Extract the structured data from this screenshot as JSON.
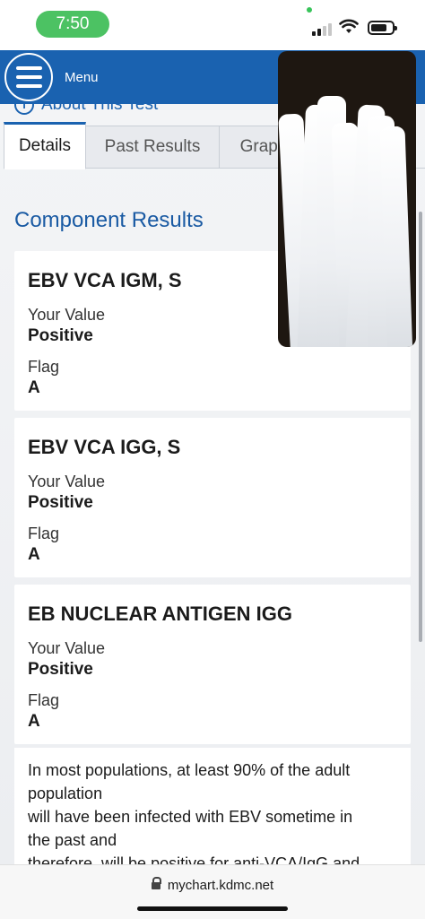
{
  "status_bar": {
    "time": "7:50"
  },
  "header": {
    "menu_label": "Menu"
  },
  "about_link": "About This Test",
  "tabs": [
    {
      "label": "Details",
      "active": true
    },
    {
      "label": "Past Results",
      "active": false
    },
    {
      "label": "Graph",
      "active": false
    }
  ],
  "section_title": "Component Results",
  "results": [
    {
      "name": "EBV VCA IGM, S",
      "value_label": "Your Value",
      "value": "Positive",
      "flag_label": "Flag",
      "flag": "A"
    },
    {
      "name": "EBV VCA IGG, S",
      "value_label": "Your Value",
      "value": "Positive",
      "flag_label": "Flag",
      "flag": "A"
    },
    {
      "name": "EB NUCLEAR ANTIGEN IGG",
      "value_label": "Your Value",
      "value": "Positive",
      "flag_label": "Flag",
      "flag": "A"
    }
  ],
  "note": {
    "lines": [
      "In most populations, at least 90% of the adult",
      "population",
      "will have been infected with EBV sometime in",
      "the past and",
      "therefore, will be positive for anti-VCA/IgG and"
    ]
  },
  "url_bar": {
    "url": "mychart.kdmc.net"
  },
  "colors": {
    "brand_blue": "#1a62b0",
    "time_pill_green": "#4cc263"
  }
}
